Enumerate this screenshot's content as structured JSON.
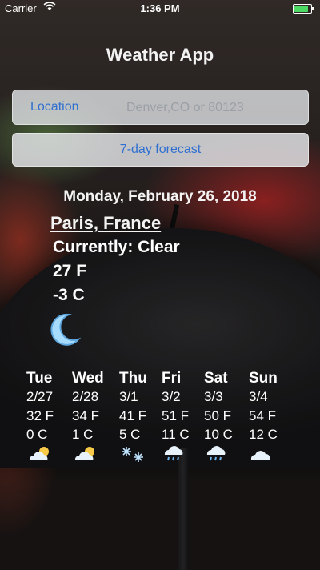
{
  "status_bar": {
    "carrier": "Carrier",
    "time": "1:36 PM"
  },
  "app": {
    "title": "Weather App"
  },
  "search": {
    "label": "Location",
    "placeholder": "Denver,CO or 80123",
    "value": ""
  },
  "forecast_button": {
    "label": "7-day forecast"
  },
  "current": {
    "date": "Monday, February 26, 2018",
    "city": "Paris, France",
    "conditions": "Currently: Clear",
    "temp_f": "27 F",
    "temp_c": "-3 C",
    "icon": "moon-icon"
  },
  "forecast": [
    {
      "day": "Tue",
      "date": "2/27",
      "temp_f": "32 F",
      "temp_c": "0 C",
      "icon": "partly-cloudy-icon"
    },
    {
      "day": "Wed",
      "date": "2/28",
      "temp_f": "34 F",
      "temp_c": "1 C",
      "icon": "partly-cloudy-icon"
    },
    {
      "day": "Thu",
      "date": "3/1",
      "temp_f": "41 F",
      "temp_c": "5 C",
      "icon": "snow-icon"
    },
    {
      "day": "Fri",
      "date": "3/2",
      "temp_f": "51 F",
      "temp_c": "11 C",
      "icon": "rain-cloud-icon"
    },
    {
      "day": "Sat",
      "date": "3/3",
      "temp_f": "50 F",
      "temp_c": "10 C",
      "icon": "rain-cloud-icon"
    },
    {
      "day": "Sun",
      "date": "3/4",
      "temp_f": "54 F",
      "temp_c": "12 C",
      "icon": "cloud-icon"
    }
  ],
  "colors": {
    "link_blue": "#2f6fd1",
    "battery_green": "#4cd964"
  }
}
